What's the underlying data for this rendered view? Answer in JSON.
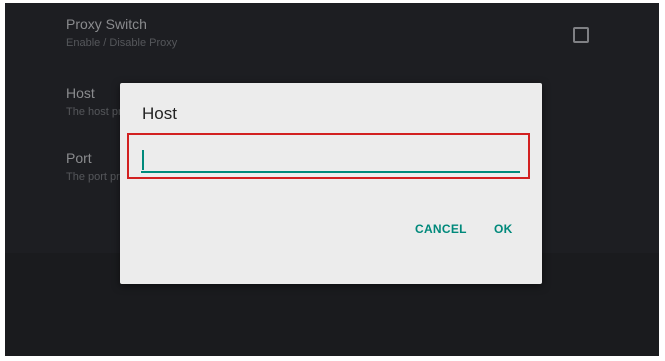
{
  "settings": {
    "proxy_switch": {
      "title": "Proxy Switch",
      "summary": "Enable / Disable Proxy",
      "checked": false
    },
    "host": {
      "title": "Host",
      "summary": "The host proxy"
    },
    "port": {
      "title": "Port",
      "summary": "The port proxy"
    }
  },
  "dialog": {
    "title": "Host",
    "input_value": "",
    "cancel_label": "CANCEL",
    "ok_label": "OK"
  },
  "colors": {
    "accent": "#00897b",
    "background": "#1d1e22",
    "dialog": "#ececec",
    "highlight": "#d22020"
  }
}
